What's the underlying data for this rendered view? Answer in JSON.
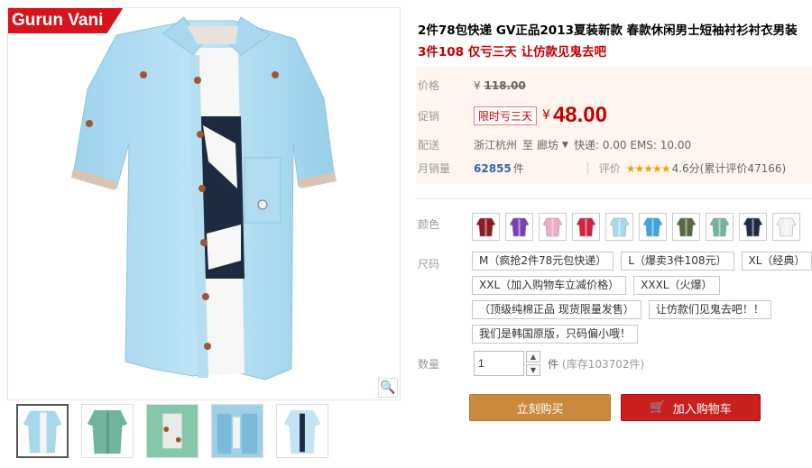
{
  "brand": "Gurun Vani",
  "product": {
    "title": "2件78包快递 GV正品2013夏装新款 春款休闲男士短袖衬衫衬衣男装",
    "subtitle": "3件108 仅亏三天 让仿款见鬼去吧"
  },
  "price": {
    "label": "价格",
    "currency": "¥",
    "original": "118.00"
  },
  "promo": {
    "label": "促销",
    "tag": "限时亏三天",
    "currency": "¥",
    "price": "48.00"
  },
  "shipping": {
    "label": "配送",
    "from": "浙江杭州",
    "to_word": "至",
    "dest": "廊坊",
    "text": "快递: 0.00 EMS: 10.00"
  },
  "sales": {
    "label": "月销量",
    "count": "62855",
    "unit": "件",
    "review_label": "评价",
    "stars": "★★★★★",
    "score": "4.6分(累计评价47166)"
  },
  "color_label": "颜色",
  "colors": [
    {
      "name": "wine-red",
      "hex": "#8a1c24"
    },
    {
      "name": "purple",
      "hex": "#7b3fb0"
    },
    {
      "name": "pink",
      "hex": "#f0a9c6"
    },
    {
      "name": "red",
      "hex": "#d3223b"
    },
    {
      "name": "light-blue",
      "hex": "#a9d7ea"
    },
    {
      "name": "sky-blue",
      "hex": "#3aa6dc"
    },
    {
      "name": "army-green",
      "hex": "#566a3e"
    },
    {
      "name": "mint",
      "hex": "#6fb59c"
    },
    {
      "name": "navy",
      "hex": "#1e2a44"
    },
    {
      "name": "white",
      "hex": "#f2f2f2"
    }
  ],
  "size_label": "尺码",
  "sizes": [
    [
      "M（疯抢2件78元包快递）",
      "L（爆卖3件108元）",
      "XL（经典）"
    ],
    [
      "XXL（加入购物车立减价格）",
      "XXXL（火爆）"
    ],
    [
      "（顶级纯棉正品 现货限量发售）",
      "让仿款们见鬼去吧！！"
    ],
    [
      "我们是韩国原版，只码偏小哦！"
    ]
  ],
  "quantity": {
    "label": "数量",
    "value": "1",
    "unit": "件",
    "stock": "(库存103702件)"
  },
  "buttons": {
    "buy_now": "立刻购买",
    "add_cart": "加入购物车"
  }
}
